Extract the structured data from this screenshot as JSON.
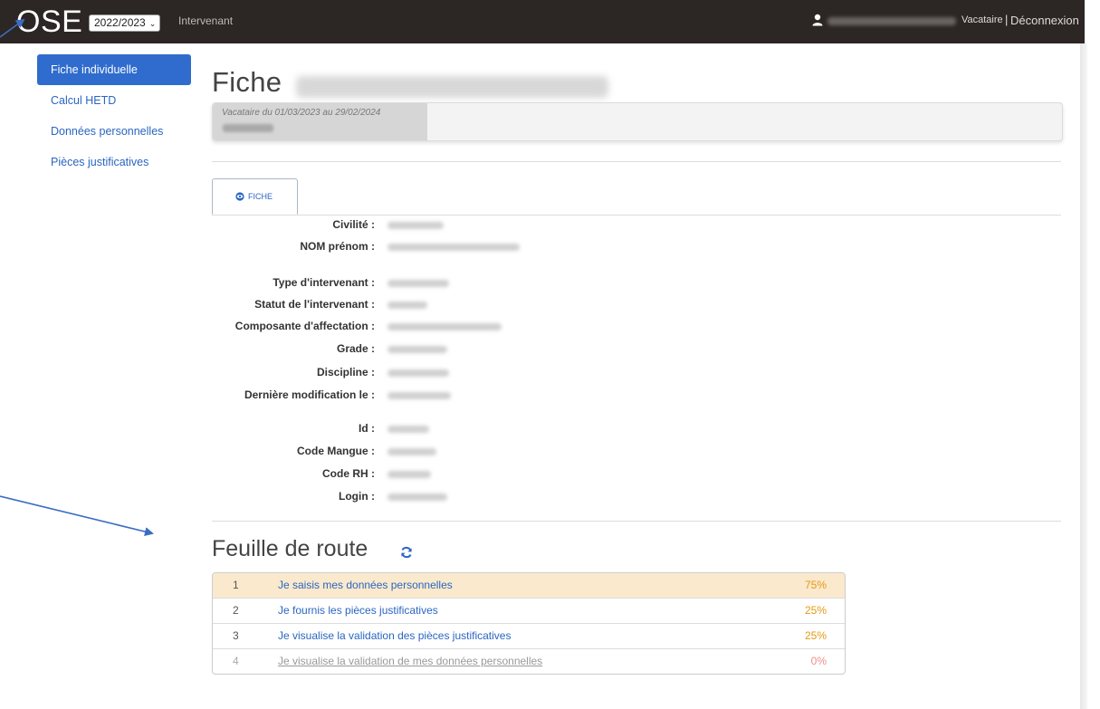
{
  "header": {
    "brand": "OSE",
    "year": "2022/2023",
    "role": "Intervenant",
    "user_status": "Vacataire",
    "separator": "|",
    "logout": "Déconnexion"
  },
  "sidebar": {
    "items": [
      {
        "label": "Fiche individuelle",
        "active": true
      },
      {
        "label": "Calcul HETD"
      },
      {
        "label": "Données personnelles"
      },
      {
        "label": "Pièces justificatives"
      }
    ]
  },
  "main": {
    "title": "Fiche",
    "period": "Vacataire du 01/03/2023 au 29/02/2024",
    "tab_label": "FICHE",
    "fields": [
      {
        "label": "Civilité :"
      },
      {
        "label": "NOM prénom :"
      },
      {
        "label": "Type d'intervenant :"
      },
      {
        "label": "Statut de l'intervenant :"
      },
      {
        "label": "Composante d'affectation :"
      },
      {
        "label": "Grade :"
      },
      {
        "label": "Discipline :"
      },
      {
        "label": "Dernière modification le :"
      },
      {
        "label": "Id :"
      },
      {
        "label": "Code Mangue :"
      },
      {
        "label": "Code RH :"
      },
      {
        "label": "Login :"
      }
    ]
  },
  "roadmap": {
    "title": "Feuille de route",
    "steps": [
      {
        "num": "1",
        "label": "Je saisis mes données personnelles",
        "pct": "75%",
        "state": "current"
      },
      {
        "num": "2",
        "label": "Je fournis les pièces justificatives",
        "pct": "25%",
        "state": "normal"
      },
      {
        "num": "3",
        "label": "Je visualise la validation des pièces justificatives",
        "pct": "25%",
        "state": "normal"
      },
      {
        "num": "4",
        "label": "Je visualise la validation de mes données personnelles",
        "pct": "0%",
        "state": "disabled"
      }
    ]
  },
  "colors": {
    "topbar": "#2c2624",
    "accent": "#2f6ccd",
    "link": "#2a66c0",
    "current_row": "#fae9cd",
    "pct": "#e59a12",
    "annotation_arrow": "#3a6cc2"
  },
  "icons": [
    "user-icon",
    "chevron-down-icon",
    "eye-icon",
    "refresh-icon"
  ]
}
